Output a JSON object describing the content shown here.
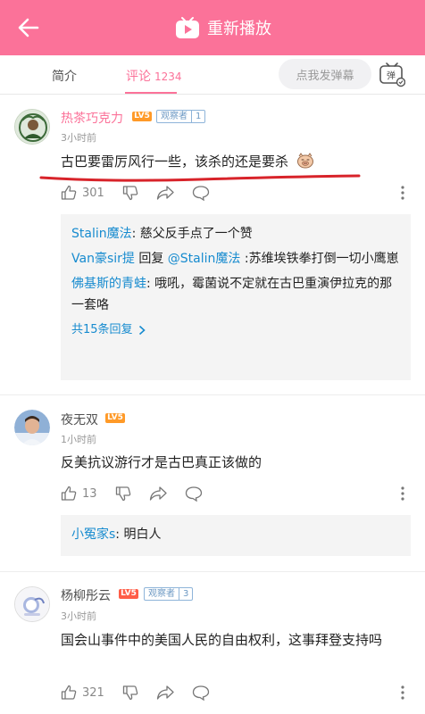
{
  "header": {
    "title": "重新播放",
    "bg_color": "#fb7299"
  },
  "tabs": {
    "intro_label": "简介",
    "comments_label": "评论",
    "comments_count": "1234",
    "danmaku_placeholder": "点我发弹幕",
    "danmaku_toggle_label": "弹"
  },
  "comments": [
    {
      "username": "热茶巧克力",
      "level": "LV5",
      "badge_label": "观察者",
      "badge_num": "1",
      "time": "3小时前",
      "text": "古巴要雷厉风行一些，该杀的还是要杀",
      "emoji": "pig-face-emoji",
      "likes": "301",
      "replies": [
        {
          "name": "Stalin魔法",
          "sep": ": ",
          "text": "慈父反手点了一个赞"
        },
        {
          "name": "Van豪sir提",
          "mid": " 回复 ",
          "target": "@Stalin魔法",
          "sep": " :",
          "text": "苏维埃铁拳打倒一切小鹰崽"
        },
        {
          "name": "佛基斯的青蛙",
          "sep": ": ",
          "text": "哦吼，霉菌说不定就在古巴重演伊拉克的那一套咯"
        }
      ],
      "replies_more": "共15条回复"
    },
    {
      "username": "夜无双",
      "level": "LV5",
      "time": "1小时前",
      "text": "反美抗议游行才是古巴真正该做的",
      "likes": "13",
      "replies": [
        {
          "name": "小冤家s",
          "sep": ": ",
          "text": "明白人"
        }
      ]
    },
    {
      "username": "杨柳彤云",
      "level": "LV5",
      "badge_label": "观察者",
      "badge_num": "3",
      "time": "3小时前",
      "text": "国会山事件中的美国人民的自由权利，这事拜登支持吗",
      "likes": "321"
    }
  ]
}
